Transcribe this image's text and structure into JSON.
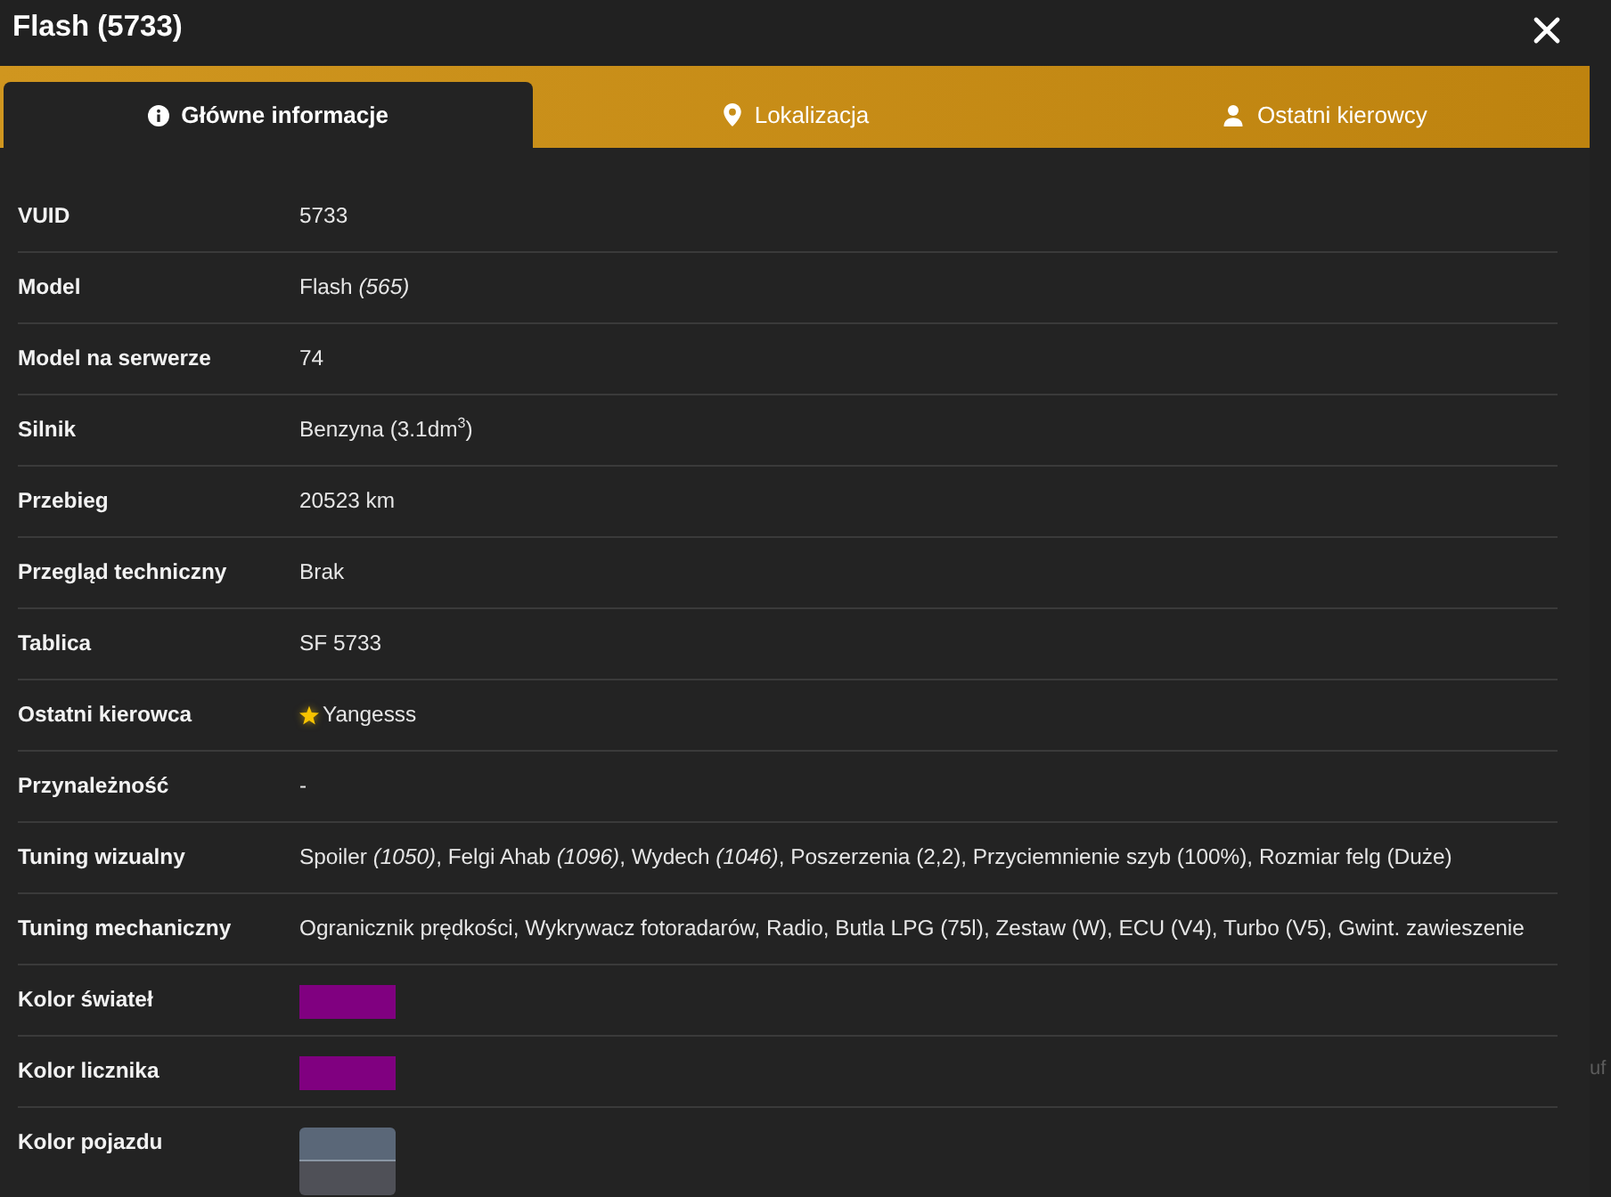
{
  "window": {
    "title": "Flash (5733)"
  },
  "tabs": [
    {
      "label": "Główne informacje",
      "selected": true
    },
    {
      "label": "Lokalizacja",
      "selected": false
    },
    {
      "label": "Ostatni kierowcy",
      "selected": false
    }
  ],
  "rows": [
    {
      "kind": "text",
      "label": "VUID",
      "value": "5733"
    },
    {
      "kind": "text",
      "label": "Model",
      "value": "Flash *(565)*"
    },
    {
      "kind": "text",
      "label": "Model na serwerze",
      "value": "74"
    },
    {
      "kind": "text",
      "label": "Silnik",
      "value": "Benzyna (3.1dm$^{3}$)"
    },
    {
      "kind": "text",
      "label": "Przebieg",
      "value": "20523 km"
    },
    {
      "kind": "text",
      "label": "Przegląd techniczny",
      "value": "Brak"
    },
    {
      "kind": "text",
      "label": "Tablica",
      "value": "SF 5733"
    },
    {
      "kind": "driver",
      "label": "Ostatni kierowca",
      "value": "Yangesss"
    },
    {
      "kind": "text",
      "label": "Przynależność",
      "value": "-"
    },
    {
      "kind": "text",
      "label": "Tuning wizualny",
      "value": "Spoiler *(1050)*, Felgi Ahab *(1096)*, Wydech *(1046)*, Poszerzenia (2,2), Przyciemnienie szyb (100%), Rozmiar felg (Duże)"
    },
    {
      "kind": "text",
      "label": "Tuning mechaniczny",
      "value": "Ogranicznik prędkości, Wykrywacz fotoradarów, Radio, Butla LPG (75l), Zestaw (W), ECU (V4), Turbo (V5), Gwint. zawieszenie"
    },
    {
      "kind": "color",
      "label": "Kolor świateł",
      "color": "#800080"
    },
    {
      "kind": "color",
      "label": "Kolor licznika",
      "color": "#800080"
    },
    {
      "kind": "multi_color",
      "label": "Kolor pojazdu",
      "swatches": [
        {
          "color": "#5a6778"
        },
        {
          "color": "#4f5057"
        }
      ]
    }
  ],
  "background_fragment": "uf"
}
